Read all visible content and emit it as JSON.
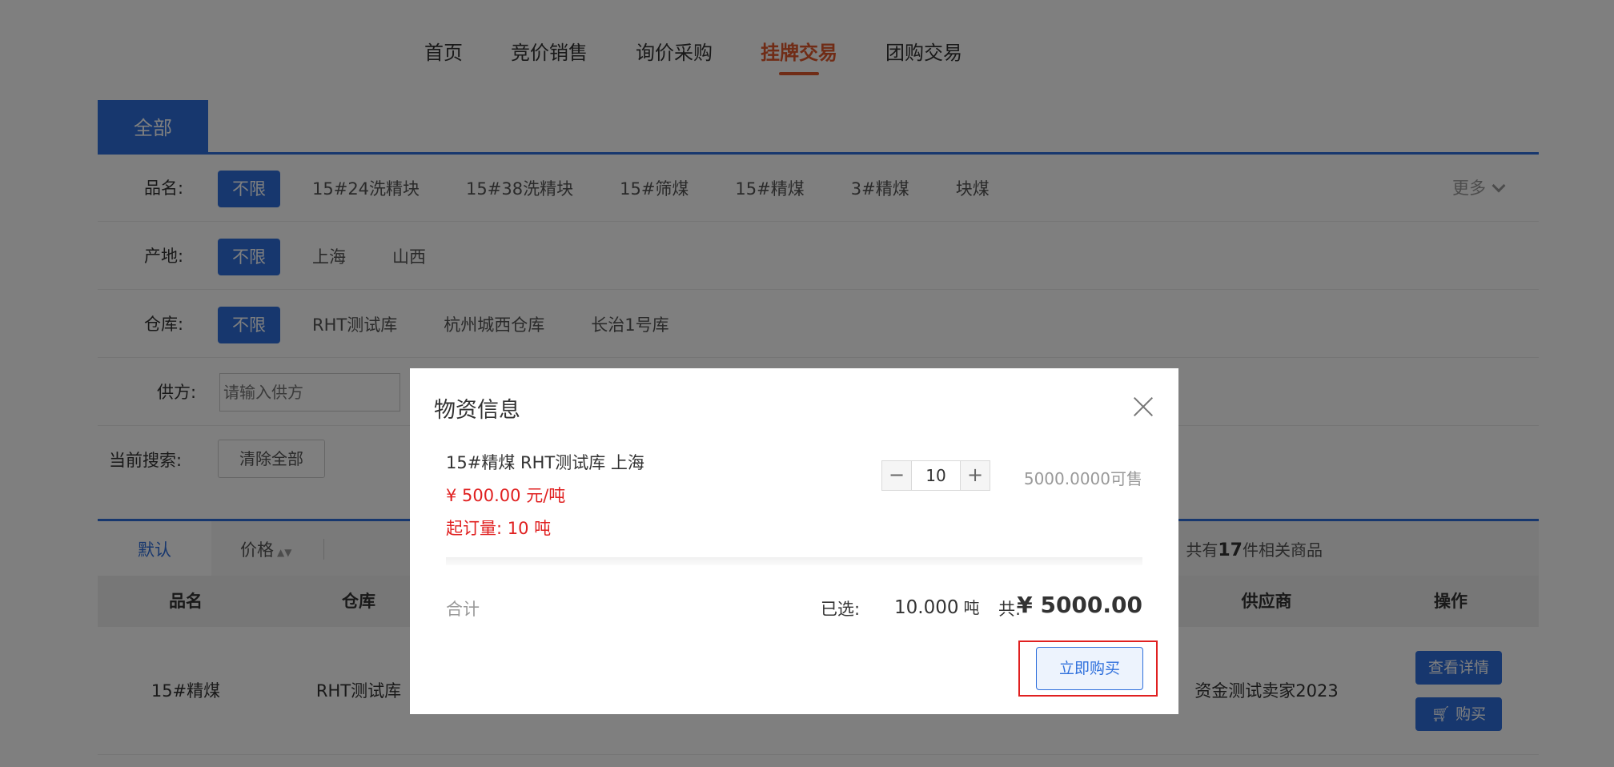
{
  "nav": {
    "items": [
      {
        "label": "首页"
      },
      {
        "label": "竞价销售"
      },
      {
        "label": "询价采购"
      },
      {
        "label": "挂牌交易",
        "active": true
      },
      {
        "label": "团购交易"
      }
    ]
  },
  "category_tab": {
    "label": "全部"
  },
  "filters": {
    "product": {
      "label": "品名:",
      "options": [
        "不限",
        "15#24洗精块",
        "15#38洗精块",
        "15#筛煤",
        "15#精煤",
        "3#精煤",
        "块煤"
      ],
      "selected": "不限",
      "more_label": "更多"
    },
    "origin": {
      "label": "产地:",
      "options": [
        "不限",
        "上海",
        "山西"
      ],
      "selected": "不限"
    },
    "warehouse": {
      "label": "仓库:",
      "options": [
        "不限",
        "RHT测试库",
        "杭州城西仓库",
        "长治1号库"
      ],
      "selected": "不限"
    },
    "supplier": {
      "label": "供方:",
      "placeholder": "请输入供方"
    },
    "current": {
      "label": "当前搜索:",
      "clear_label": "清除全部"
    }
  },
  "sort": {
    "default_label": "默认",
    "price_label": "价格",
    "total_prefix": "共有",
    "total_count": "17",
    "total_suffix": "件相关商品"
  },
  "table": {
    "headers": {
      "name": "品名",
      "warehouse": "仓库",
      "supplier": "供应商",
      "action": "操作"
    },
    "rows": [
      {
        "name": "15#精煤",
        "warehouse": "RHT测试库",
        "supplier": "资金测试卖家2023",
        "detail_label": "查看详情",
        "buy_label": "购买"
      }
    ]
  },
  "modal": {
    "title": "物资信息",
    "item_name": "15#精煤 RHT测试库 上海",
    "price": "¥ 500.00 元/吨",
    "moq": "起订量: 10 吨",
    "quantity": "10",
    "available": "5000.0000可售",
    "sum_label": "合计",
    "selected_label": "已选:",
    "selected_value": "10.000",
    "selected_unit": "吨",
    "total_label": "共:",
    "total_value": "¥ 5000.00",
    "buy_now_label": "立即购买"
  }
}
